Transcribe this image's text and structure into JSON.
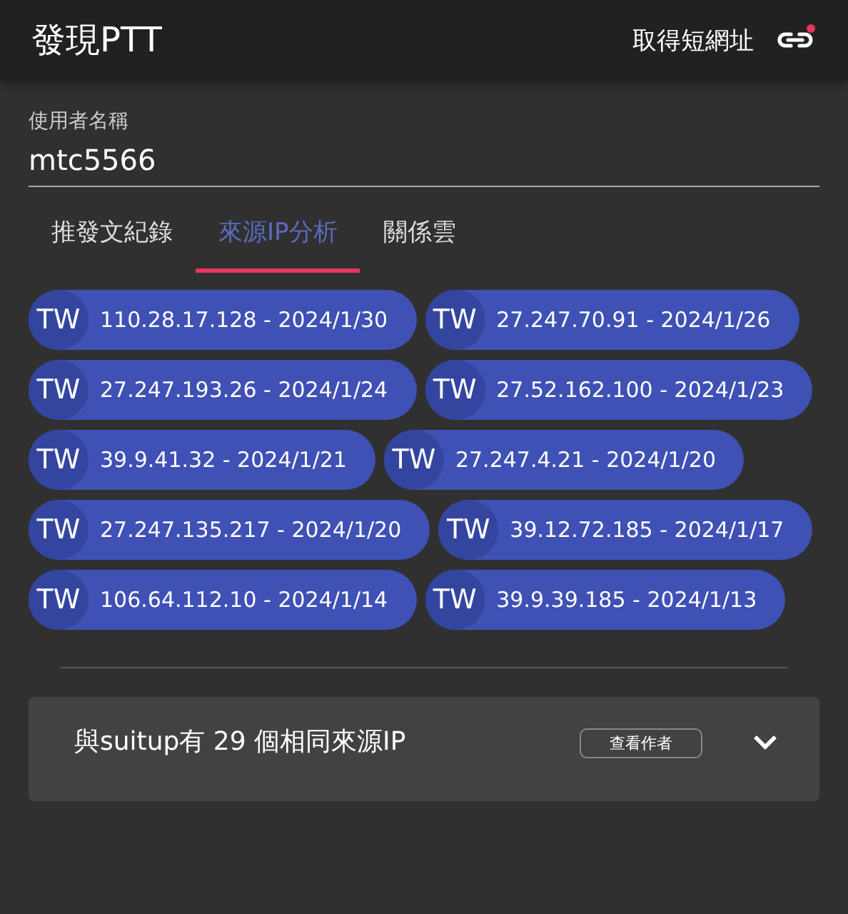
{
  "app_bar": {
    "title": "發現PTT",
    "action": "取得短網址"
  },
  "username_field": {
    "label": "使用者名稱",
    "value": "mtc5566"
  },
  "tabs": [
    {
      "label": "推發文紀錄",
      "selected": false
    },
    {
      "label": "來源IP分析",
      "selected": true
    },
    {
      "label": "關係雲",
      "selected": false
    }
  ],
  "ip_chips": [
    {
      "country": "TW",
      "text": "110.28.17.128 - 2024/1/30"
    },
    {
      "country": "TW",
      "text": "27.247.70.91 - 2024/1/26"
    },
    {
      "country": "TW",
      "text": "27.247.193.26 - 2024/1/24"
    },
    {
      "country": "TW",
      "text": "27.52.162.100 - 2024/1/23"
    },
    {
      "country": "TW",
      "text": "39.9.41.32 - 2024/1/21"
    },
    {
      "country": "TW",
      "text": "27.247.4.21 - 2024/1/20"
    },
    {
      "country": "TW",
      "text": "27.247.135.217 - 2024/1/20"
    },
    {
      "country": "TW",
      "text": "39.12.72.185 - 2024/1/17"
    },
    {
      "country": "TW",
      "text": "106.64.112.10 - 2024/1/14"
    },
    {
      "country": "TW",
      "text": "39.9.39.185 - 2024/1/13"
    }
  ],
  "panels": [
    {
      "title": "與suitup有 29 個相同來源IP",
      "button": "查看作者",
      "expanded": false
    }
  ]
}
